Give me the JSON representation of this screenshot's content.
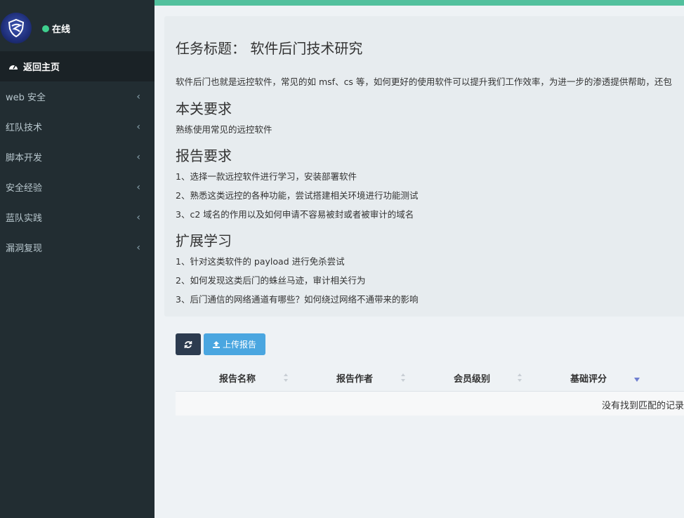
{
  "sidebar": {
    "status_text": "在线",
    "home_label": "返回主页",
    "items": [
      {
        "label": "web 安全"
      },
      {
        "label": "红队技术"
      },
      {
        "label": "脚本开发"
      },
      {
        "label": "安全经验"
      },
      {
        "label": "蓝队实践"
      },
      {
        "label": "漏洞复现"
      }
    ],
    "chevron": "‹"
  },
  "task": {
    "title": "任务标题：  软件后门技术研究",
    "description": "软件后门也就是远控软件，常见的如 msf、cs 等，如何更好的使用软件可以提升我们工作效率，为进一步的渗透提供帮助，还包",
    "requirement_heading": "本关要求",
    "requirement_text": "熟练使用常见的远控软件",
    "report_heading": "报告要求",
    "report_items": [
      "1、选择一款远控软件进行学习，安装部署软件",
      "2、熟悉这类远控的各种功能，尝试搭建相关环境进行功能测试",
      "3、c2 域名的作用以及如何申请不容易被封或者被审计的域名"
    ],
    "extend_heading": "扩展学习",
    "extend_items": [
      "1、针对这类软件的 payload 进行免杀尝试",
      "2、如何发现这类后门的蛛丝马迹，审计相关行为",
      "3、后门通信的网络通道有哪些？如何绕过网络不通带来的影响"
    ]
  },
  "toolbar": {
    "upload_label": "上传报告"
  },
  "table": {
    "columns": [
      "报告名称",
      "报告作者",
      "会员级别",
      "基础评分"
    ],
    "empty_text": "没有找到匹配的记录"
  },
  "colors": {
    "accent": "#52c09d",
    "sidebar": "#222d32",
    "upload_button": "#4aa6e0",
    "refresh_button": "#2c3b4f"
  }
}
